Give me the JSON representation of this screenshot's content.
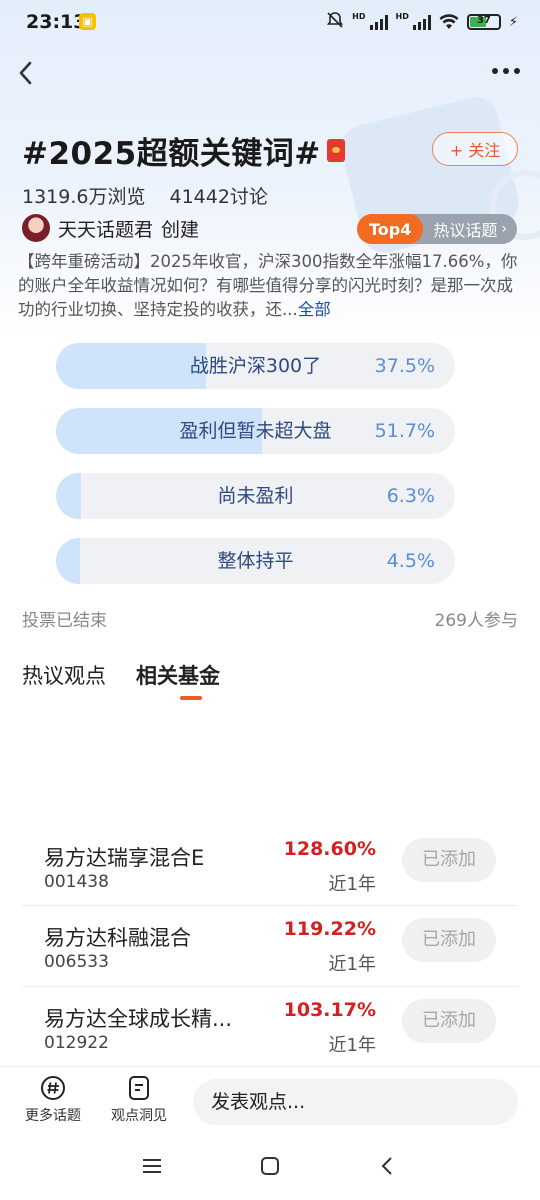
{
  "status_bar": {
    "time": "23:13",
    "battery": "37"
  },
  "topic": {
    "title": "#2025超额关键词#",
    "follow_label": "+ 关注",
    "views": "1319.6万浏览",
    "discussions": "41442讨论",
    "creator_name": "天天话题君",
    "creator_suffix": "创建",
    "rank": "Top4",
    "rank_label": "热议话题",
    "description": "【跨年重磅活动】2025年收官，沪深300指数全年涨幅17.66%，你的账户全年收益情况如何？有哪些值得分享的闪光时刻？是那一次成功的行业切换、坚持定投的收获，还...",
    "more_label": "全部"
  },
  "poll": {
    "options": [
      {
        "label": "战胜沪深300了",
        "pct": "37.5%",
        "value": 37.5
      },
      {
        "label": "盈利但暂未超大盘",
        "pct": "51.7%",
        "value": 51.7
      },
      {
        "label": "尚未盈利",
        "pct": "6.3%",
        "value": 6.3
      },
      {
        "label": "整体持平",
        "pct": "4.5%",
        "value": 4.5
      }
    ],
    "status": "投票已结束",
    "participants": "269人参与"
  },
  "tabs": [
    {
      "label": "热议观点",
      "active": false
    },
    {
      "label": "相关基金",
      "active": true
    }
  ],
  "funds": [
    {
      "name": "易方达瑞享混合E",
      "code": "001438",
      "return": "128.60%",
      "period": "近1年",
      "button": "已添加"
    },
    {
      "name": "易方达科融混合",
      "code": "006533",
      "return": "119.22%",
      "period": "近1年",
      "button": "已添加"
    },
    {
      "name": "易方达全球成长精...",
      "code": "012922",
      "return": "103.17%",
      "period": "近1年",
      "button": "已添加"
    }
  ],
  "bottom_bar": {
    "more_topics": "更多话题",
    "insights": "观点洞见",
    "input_placeholder": "发表观点..."
  },
  "colors": {
    "accent": "#f05a2a",
    "rank_badge": "#f26b20",
    "poll_fill": "#cfe3fb",
    "return_red": "#d61f1f"
  }
}
